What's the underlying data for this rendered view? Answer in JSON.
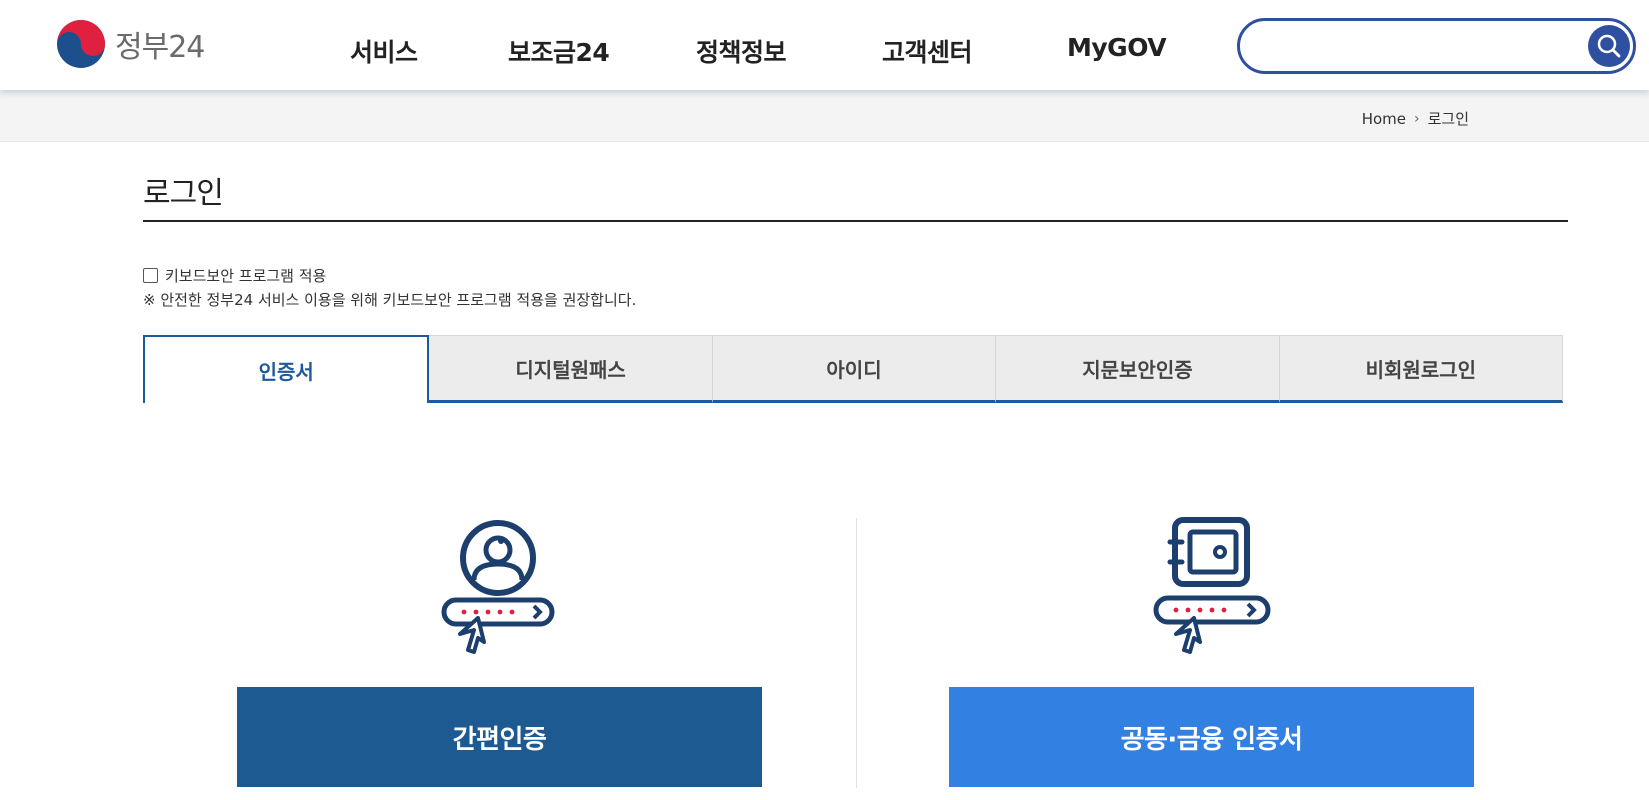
{
  "header": {
    "logo_text": "정부24",
    "nav": [
      "서비스",
      "보조금24",
      "정책정보",
      "고객센터",
      "MyGOV"
    ],
    "search": {
      "value": "",
      "placeholder": ""
    }
  },
  "breadcrumb": {
    "home": "Home",
    "current": "로그인"
  },
  "page": {
    "title": "로그인"
  },
  "keyboard_security": {
    "label": "키보드보안 프로그램 적용",
    "checked": false,
    "notice": "※ 안전한 정부24 서비스 이용을 위해 키보드보안 프로그램 적용을 권장합니다."
  },
  "tabs": [
    {
      "label": "인증서",
      "active": true
    },
    {
      "label": "디지털원패스",
      "active": false
    },
    {
      "label": "아이디",
      "active": false
    },
    {
      "label": "지문보안인증",
      "active": false
    },
    {
      "label": "비회원로그인",
      "active": false
    }
  ],
  "options": {
    "simple_auth_label": "간편인증",
    "joint_cert_label": "공동·금융 인증서"
  },
  "colors": {
    "primary_dark": "#1d5a92",
    "primary_light": "#3380e3",
    "search_border": "#2f4fa0",
    "icon_navy": "#1c3f6e",
    "icon_red": "#e0203f"
  }
}
